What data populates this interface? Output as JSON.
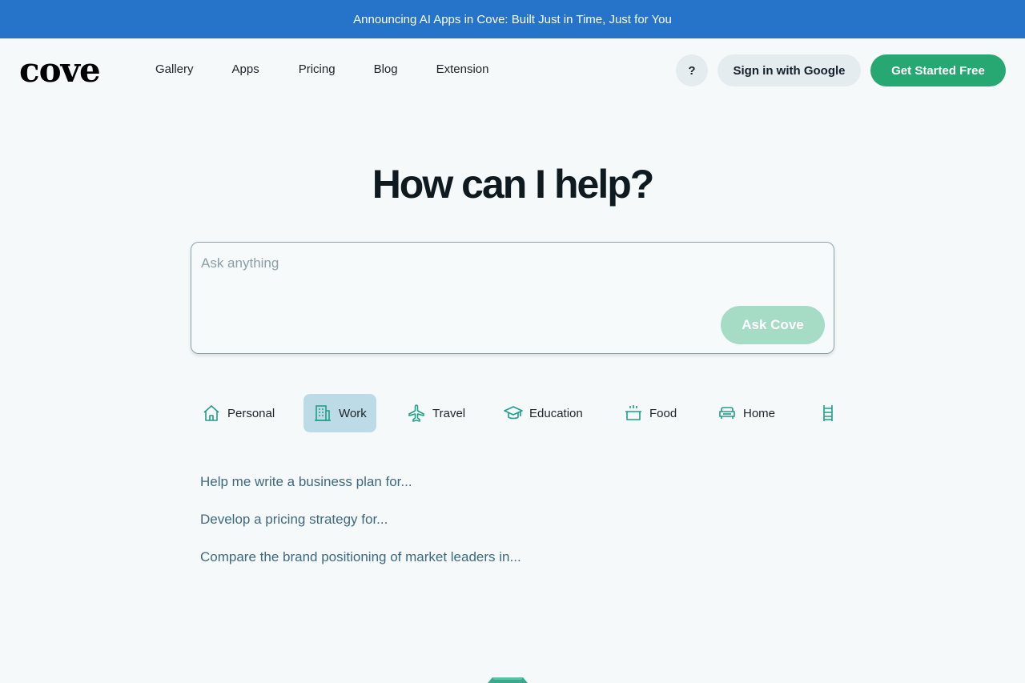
{
  "announcement": "Announcing AI Apps in Cove: Built Just in Time, Just for You",
  "brand": {
    "logo": "cove"
  },
  "nav": {
    "links": [
      "Gallery",
      "Apps",
      "Pricing",
      "Blog",
      "Extension"
    ],
    "help_label": "?",
    "signin_label": "Sign in with Google",
    "start_label": "Get Started Free"
  },
  "hero": {
    "title": "How can I help?"
  },
  "ask": {
    "placeholder": "Ask anything",
    "button_label": "Ask Cove"
  },
  "categories": [
    {
      "label": "Personal",
      "icon": "house-icon",
      "active": false
    },
    {
      "label": "Work",
      "icon": "building-icon",
      "active": true
    },
    {
      "label": "Travel",
      "icon": "airplane-icon",
      "active": false
    },
    {
      "label": "Education",
      "icon": "graduation-cap-icon",
      "active": false
    },
    {
      "label": "Food",
      "icon": "cooking-pot-icon",
      "active": false
    },
    {
      "label": "Home",
      "icon": "sofa-icon",
      "active": false
    },
    {
      "label": "",
      "icon": "ladder-icon",
      "active": false
    }
  ],
  "suggestions": [
    "Help me write a business plan for...",
    "Develop a pricing strategy for...",
    "Compare the brand positioning of market leaders in..."
  ],
  "colors": {
    "announce_bg": "#2574c9",
    "accent_green": "#27a772",
    "ask_button_disabled": "#a6dcc6",
    "active_category": "#bcdbe6",
    "icon_teal": "#1f9e8a",
    "suggestion_text": "#3d6a80"
  }
}
